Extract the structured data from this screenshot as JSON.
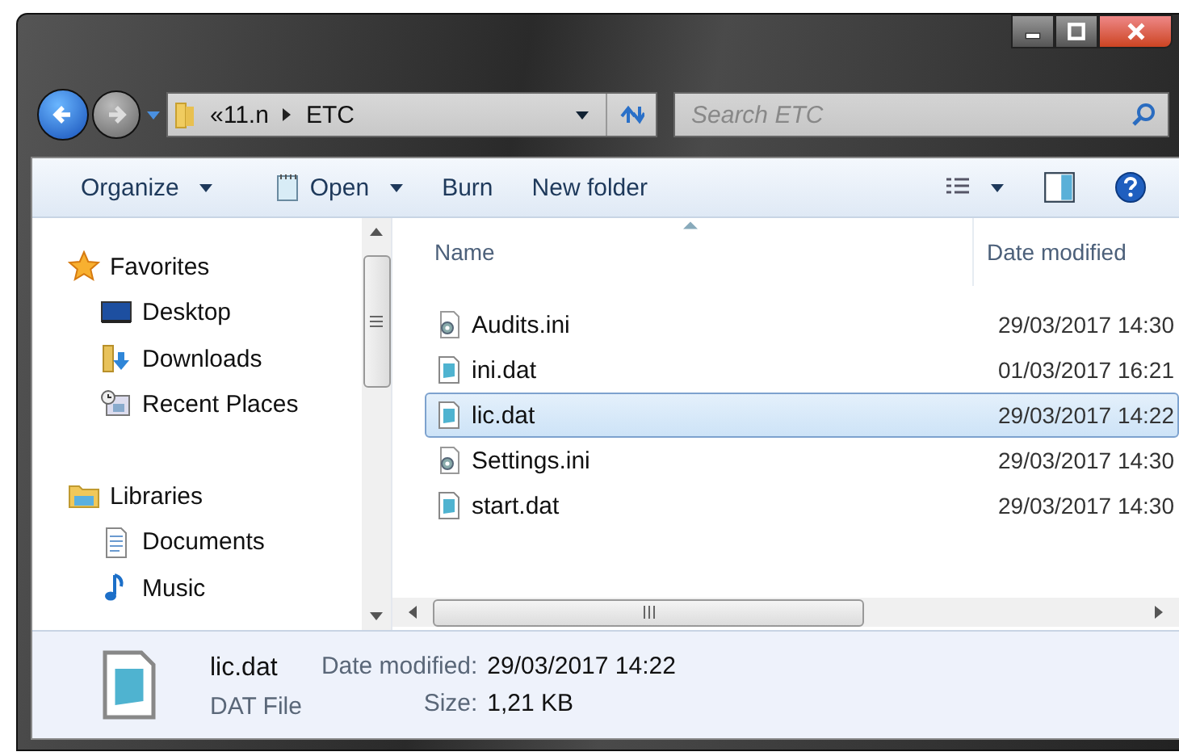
{
  "address_bar": {
    "overflow": "«",
    "path": [
      "11.n",
      "ETC"
    ]
  },
  "search": {
    "placeholder": "Search ETC"
  },
  "toolbar": [
    {
      "label": "Organize",
      "kind": "dropdown"
    },
    {
      "label": "Open",
      "kind": "icon-dropdown"
    },
    {
      "label": "Burn",
      "kind": "plain"
    },
    {
      "label": "New folder",
      "kind": "plain"
    }
  ],
  "sidebar": [
    {
      "label": "Favorites",
      "kind": "star",
      "children": [
        {
          "label": "Desktop",
          "kind": "desktop"
        },
        {
          "label": "Downloads",
          "kind": "downloads"
        },
        {
          "label": "Recent Places",
          "kind": "recent"
        }
      ]
    },
    {
      "label": "Libraries",
      "kind": "library",
      "children": [
        {
          "label": "Documents",
          "kind": "document"
        },
        {
          "label": "Music",
          "kind": "music"
        }
      ]
    }
  ],
  "columns": [
    {
      "label": "Name",
      "sorted": true
    },
    {
      "label": "Date modified",
      "sorted": false
    }
  ],
  "files": [
    {
      "name": "Audits.ini",
      "date": "29/03/2017 14:30",
      "kind": "settings",
      "selected": false
    },
    {
      "name": "ini.dat",
      "date": "01/03/2017 16:21",
      "kind": "data",
      "selected": false
    },
    {
      "name": "lic.dat",
      "date": "29/03/2017 14:22",
      "kind": "data",
      "selected": true
    },
    {
      "name": "Settings.ini",
      "date": "29/03/2017 14:30",
      "kind": "settings",
      "selected": false
    },
    {
      "name": "start.dat",
      "date": "29/03/2017 14:30",
      "kind": "data",
      "selected": false
    }
  ],
  "details": {
    "name": "lic.dat",
    "type": "DAT File",
    "fields": [
      {
        "label": "Date modified:",
        "value": "29/03/2017 14:22"
      },
      {
        "label": "Size:",
        "value": "1,21 KB"
      }
    ]
  }
}
